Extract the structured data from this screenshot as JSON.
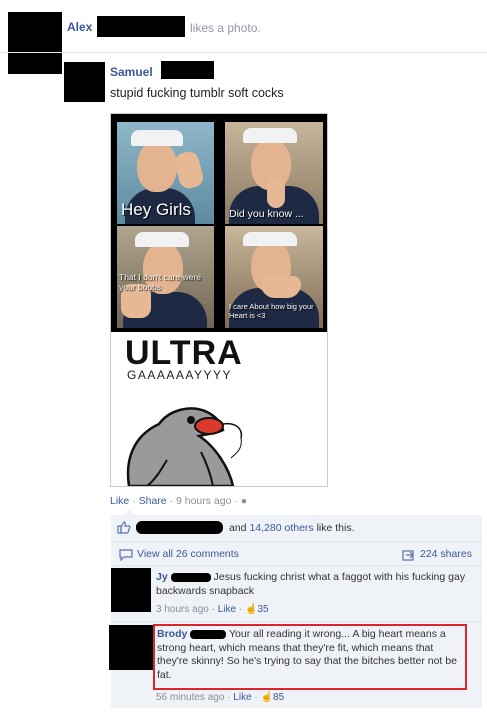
{
  "activity": {
    "actor_name": "Alex",
    "action_text": "likes a photo."
  },
  "post": {
    "author_name": "Samuel",
    "status_text": "stupid fucking tumblr soft cocks",
    "image": {
      "panel_captions": [
        "Hey Girls",
        "Did you know ...",
        "That I don't care were your boobs",
        "I care About how big your Heart is <3"
      ],
      "meme_title": "ULTRA",
      "meme_subtitle": "GAAAAAAYYYY"
    },
    "actions": {
      "like_label": "Like",
      "share_label": "Share",
      "timestamp": "9 hours ago",
      "sep": "·"
    }
  },
  "feedback": {
    "likes_text": "and",
    "likes_others": "14,280 others",
    "likes_suffix": "like this.",
    "view_all_label": "View all 26 comments",
    "shares_label": "224 shares"
  },
  "comments": [
    {
      "author": "Jy",
      "text": "Jesus fucking christ what a faggot with his fucking gay backwards snapback",
      "time": "3 hours ago",
      "like_label": "Like",
      "likes": "35",
      "highlighted": false
    },
    {
      "author": "Brody",
      "text": "Your all reading it wrong... A big heart means a strong heart, which means that they're fit, which means that they're skinny! So he's trying to say that the bitches better not be fat.",
      "time": "56 minutes ago",
      "like_label": "Like",
      "likes": "85",
      "highlighted": true
    }
  ],
  "colors": {
    "link": "#3b5998",
    "comment_bg": "#eff2f7",
    "highlight_border": "#d9262c",
    "redaction": "#000000"
  },
  "icons": [
    "thumbs-up-icon",
    "speech-bubble-icon",
    "share-icon",
    "globe-icon"
  ]
}
